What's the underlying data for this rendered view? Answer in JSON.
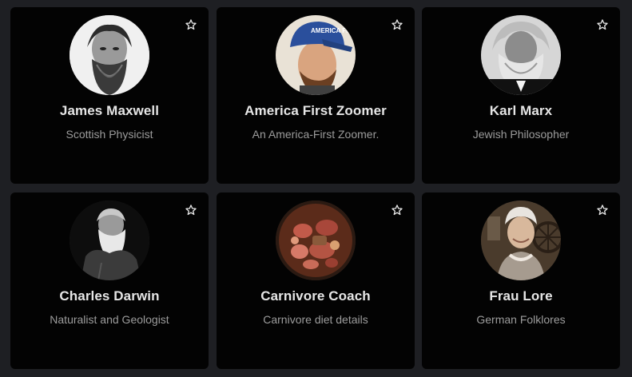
{
  "cards": [
    {
      "name": "James Maxwell",
      "description": "Scottish Physicist",
      "avatar": "portrait-grayscale",
      "icon": "star-icon"
    },
    {
      "name": "America First Zoomer",
      "description": "An America-First Zoomer.",
      "avatar": "portrait-cap",
      "icon": "star-icon",
      "cap_text": "AMERICA FIRST"
    },
    {
      "name": "Karl Marx",
      "description": "Jewish Philosopher",
      "avatar": "portrait-grayscale",
      "icon": "star-icon"
    },
    {
      "name": "Charles Darwin",
      "description": "Naturalist and Geologist",
      "avatar": "portrait-grayscale",
      "icon": "star-icon"
    },
    {
      "name": "Carnivore Coach",
      "description": "Carnivore diet details",
      "avatar": "meat-platter",
      "icon": "star-icon"
    },
    {
      "name": "Frau Lore",
      "description": "German Folklores",
      "avatar": "portrait-sepia",
      "icon": "star-icon"
    }
  ],
  "colors": {
    "page_background": "#1e1f23",
    "card_background": "#030303",
    "name_text": "#e6e6e6",
    "description_text": "#9c9c9c"
  }
}
